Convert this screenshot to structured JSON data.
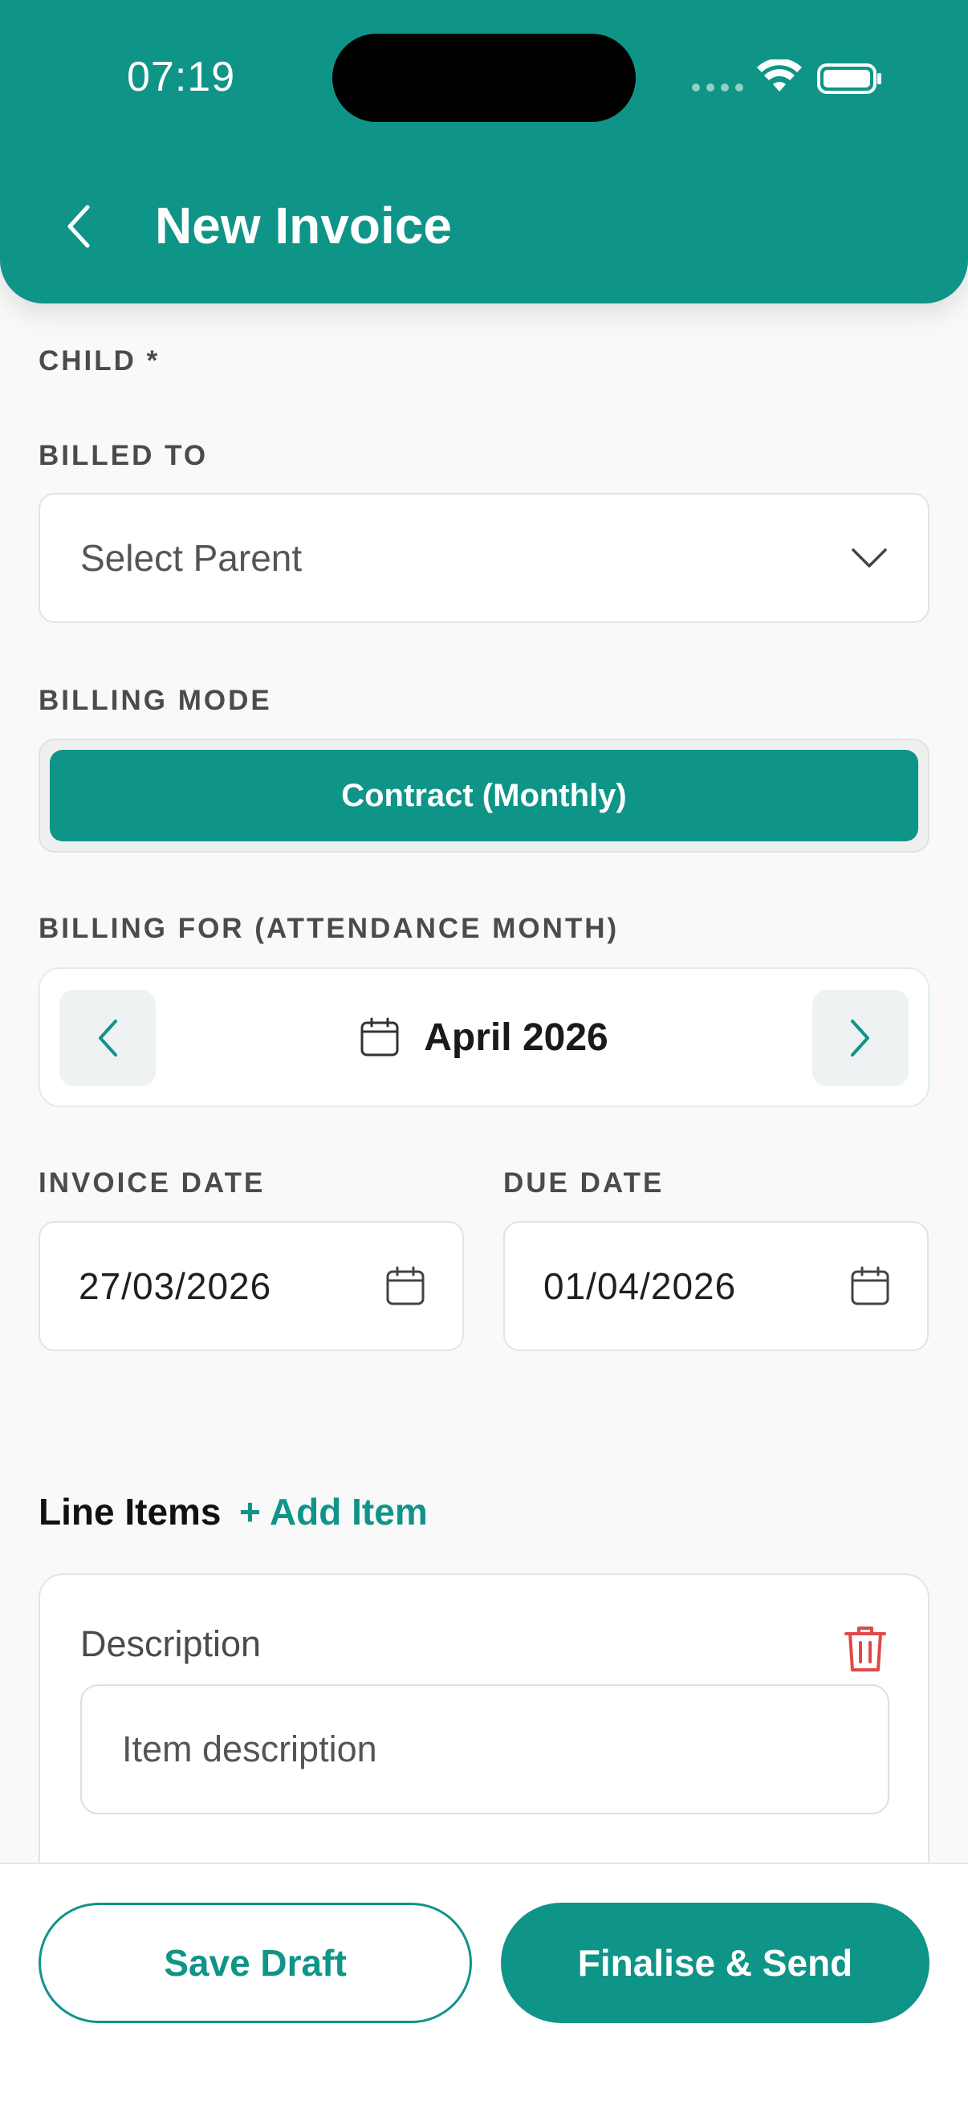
{
  "status_bar": {
    "time": "07:19"
  },
  "header": {
    "title": "New Invoice",
    "back_icon": "chevron-left-icon"
  },
  "form": {
    "child_label": "CHILD *",
    "billed_to": {
      "label": "BILLED TO",
      "value": "Select Parent",
      "icon": "chevron-down-icon"
    },
    "billing_mode": {
      "label": "BILLING MODE",
      "selected": "Contract (Monthly)"
    },
    "billing_for": {
      "label": "BILLING FOR (ATTENDANCE MONTH)",
      "month": "April 2026"
    },
    "invoice_date": {
      "label": "INVOICE DATE",
      "value": "27/03/2026"
    },
    "due_date": {
      "label": "DUE DATE",
      "value": "01/04/2026"
    }
  },
  "line_items": {
    "title": "Line Items",
    "add_label": "+ Add Item",
    "items": [
      {
        "description_label": "Description",
        "description_placeholder": "Item description"
      }
    ]
  },
  "actions": {
    "save_draft": "Save Draft",
    "finalise_send": "Finalise & Send"
  },
  "colors": {
    "primary": "#0f9488",
    "danger": "#e04848",
    "background": "#f9f9f9"
  }
}
